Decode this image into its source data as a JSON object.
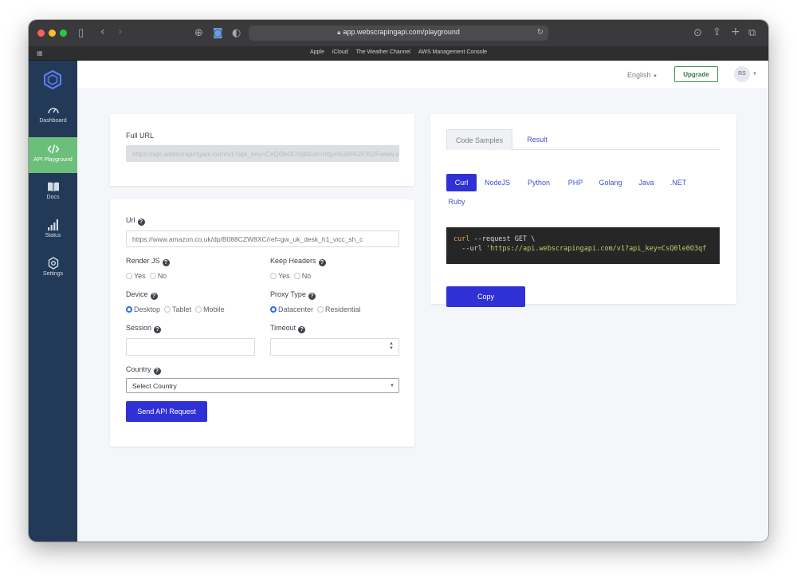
{
  "browser": {
    "url": "app.webscrapingapi.com/playground",
    "favorites": [
      "Apple",
      "iCloud",
      "The Weather Channel",
      "AWS Management Console"
    ]
  },
  "sidebar": {
    "items": [
      {
        "label": "Dashboard",
        "icon": "gauge-icon"
      },
      {
        "label": "API Playground",
        "icon": "code-icon",
        "active": true
      },
      {
        "label": "Docs",
        "icon": "book-icon"
      },
      {
        "label": "Status",
        "icon": "signal-bars-icon"
      },
      {
        "label": "Settings",
        "icon": "gear-icon"
      }
    ]
  },
  "header": {
    "language": "English",
    "upgrade_label": "Upgrade",
    "avatar_initials": "RS"
  },
  "full_url": {
    "label": "Full URL",
    "value": "https://api.webscrapingapi.com/v1?api_key=CsQ0le0O3qf&url=https%3A%2F%2Fwww.amazon"
  },
  "form": {
    "url_label": "Url",
    "url_value": "https://www.amazon.co.uk/dp/B088CZW8XC/ref=gw_uk_desk_h1_vicc_sh_c",
    "render_js": {
      "label": "Render JS",
      "options": [
        "Yes",
        "No"
      ]
    },
    "keep_headers": {
      "label": "Keep Headers",
      "options": [
        "Yes",
        "No"
      ]
    },
    "device": {
      "label": "Device",
      "options": [
        "Desktop",
        "Tablet",
        "Mobile"
      ],
      "selected": "Desktop"
    },
    "proxy_type": {
      "label": "Proxy Type",
      "options": [
        "Datacenter",
        "Residential"
      ],
      "selected": "Datacenter"
    },
    "session_label": "Session",
    "timeout_label": "Timeout",
    "country_label": "Country",
    "country_value": "Select Country",
    "submit_label": "Send API Request"
  },
  "code_panel": {
    "tabs": [
      "Code Samples",
      "Result"
    ],
    "active_tab": "Code Samples",
    "languages": [
      "Curl",
      "NodeJS",
      "Python",
      "PHP",
      "Golang",
      "Java",
      ".NET",
      "Ruby"
    ],
    "active_language": "Curl",
    "code_line1_cmd": "curl",
    "code_line1_rest": " --request GET \\",
    "code_line2_flag": "  --url ",
    "code_line2_str": "'https://api.webscrapingapi.com/v1?api_key=CsQ0le0O3qf",
    "copy_label": "Copy"
  },
  "colors": {
    "sidebar_bg": "#223a57",
    "sidebar_active": "#6bbf7a",
    "primary": "#2f31d6",
    "link": "#3c52cf",
    "upgrade_green": "#3c9b4f"
  }
}
